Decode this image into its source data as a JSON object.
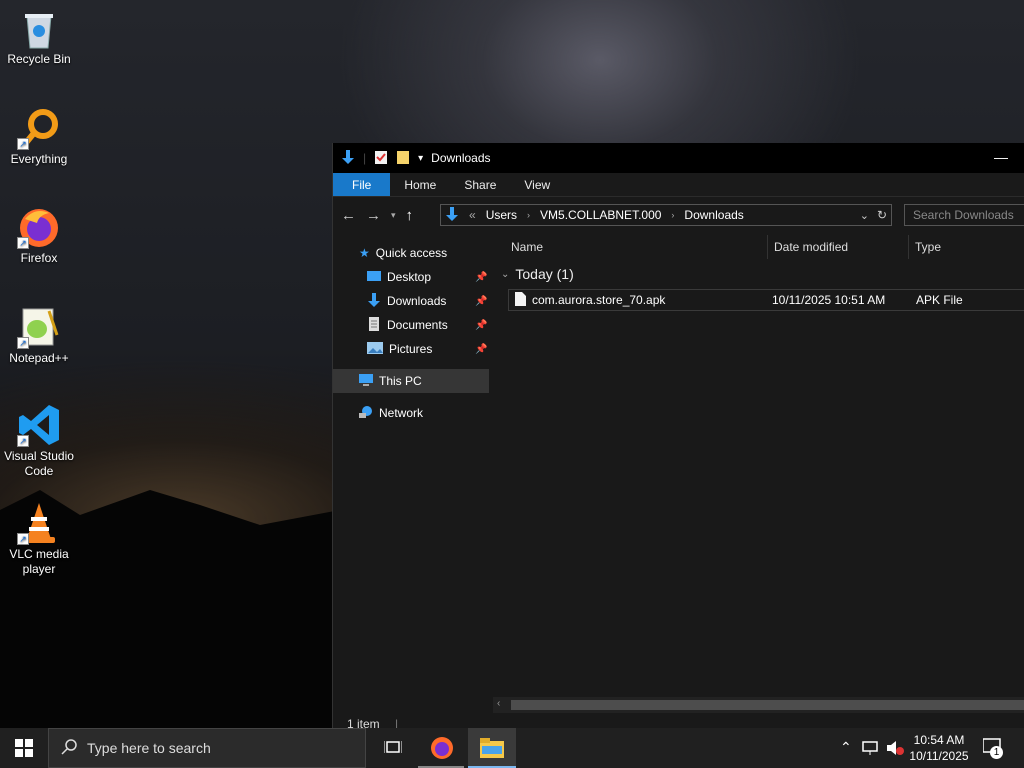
{
  "desktop": {
    "icons": [
      {
        "label": "Recycle Bin",
        "icon": "recycle-bin-icon"
      },
      {
        "label": "Everything",
        "icon": "everything-icon"
      },
      {
        "label": "Firefox",
        "icon": "firefox-icon"
      },
      {
        "label": "Notepad++",
        "icon": "notepadpp-icon"
      },
      {
        "label": "Visual Studio Code",
        "icon": "vscode-icon"
      },
      {
        "label": "VLC media player",
        "icon": "vlc-icon"
      }
    ]
  },
  "explorer": {
    "title": "Downloads",
    "ribbon": {
      "file": "File",
      "home": "Home",
      "share": "Share",
      "view": "View"
    },
    "address": {
      "overflow": "«",
      "parts": [
        "Users",
        "VM5.COLLABNET.000",
        "Downloads"
      ]
    },
    "search_placeholder": "Search Downloads",
    "sidebar": {
      "quick_access": "Quick access",
      "desktop": "Desktop",
      "downloads": "Downloads",
      "documents": "Documents",
      "pictures": "Pictures",
      "this_pc": "This PC",
      "network": "Network"
    },
    "columns": {
      "name": "Name",
      "date": "Date modified",
      "type": "Type"
    },
    "group": "Today (1)",
    "files": [
      {
        "name": "com.aurora.store_70.apk",
        "date": "10/11/2025 10:51 AM",
        "type": "APK File"
      }
    ],
    "status": "1 item"
  },
  "taskbar": {
    "search_placeholder": "Type here to search",
    "time": "10:54 AM",
    "date": "10/11/2025",
    "notification_count": "1"
  },
  "colors": {
    "accent": "#1979ca",
    "selected": "#363636",
    "taskbar": "#202020",
    "window": "#191919"
  }
}
